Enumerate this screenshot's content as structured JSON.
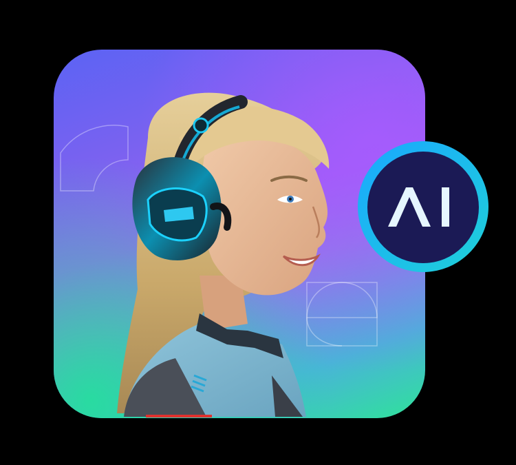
{
  "badge": {
    "label": "AI",
    "ring_color": "#1aa8ff",
    "core_color": "#1b1a55",
    "text_color": "#e6f6ff"
  },
  "background": {
    "page_color": "#000000",
    "gradient_top": "#5b63f4",
    "gradient_mid": "#9a5ff5",
    "gradient_bottom": "#2fe29a"
  },
  "figure": {
    "subject": "smiling-woman-with-headset-icon"
  }
}
